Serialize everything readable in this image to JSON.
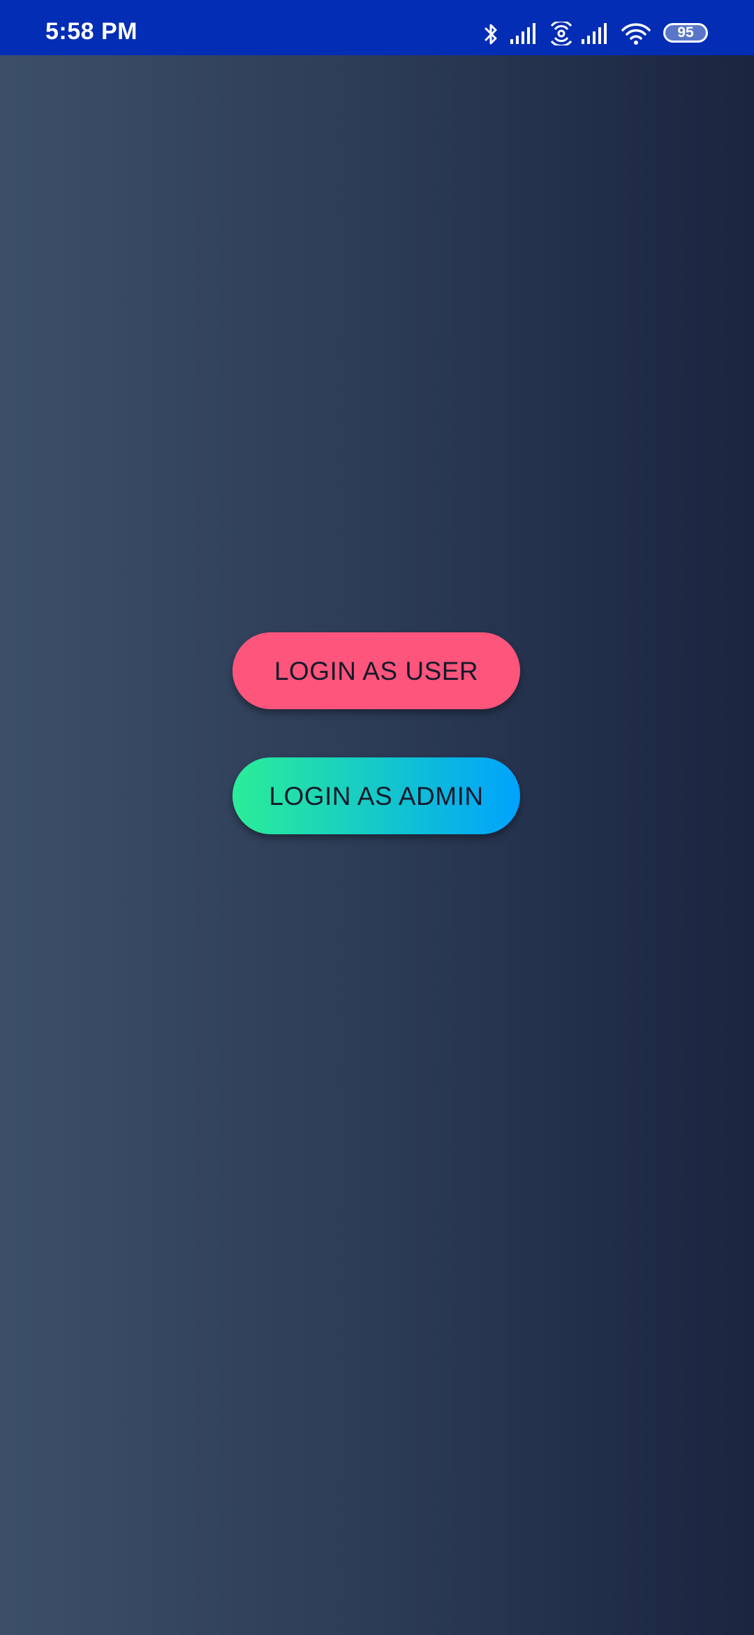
{
  "status_bar": {
    "time": "5:58 PM",
    "battery_level": "95",
    "icons": [
      "bluetooth-icon",
      "signal-icon",
      "hotspot-icon",
      "signal-icon",
      "wifi-icon",
      "battery-icon"
    ],
    "background_color": "#042db5"
  },
  "login": {
    "user_button_label": "LOGIN AS USER",
    "admin_button_label": "LOGIN AS ADMIN",
    "user_button_color": "#fd557c",
    "admin_button_gradient": [
      "#2bed98",
      "#00a2fd"
    ]
  }
}
